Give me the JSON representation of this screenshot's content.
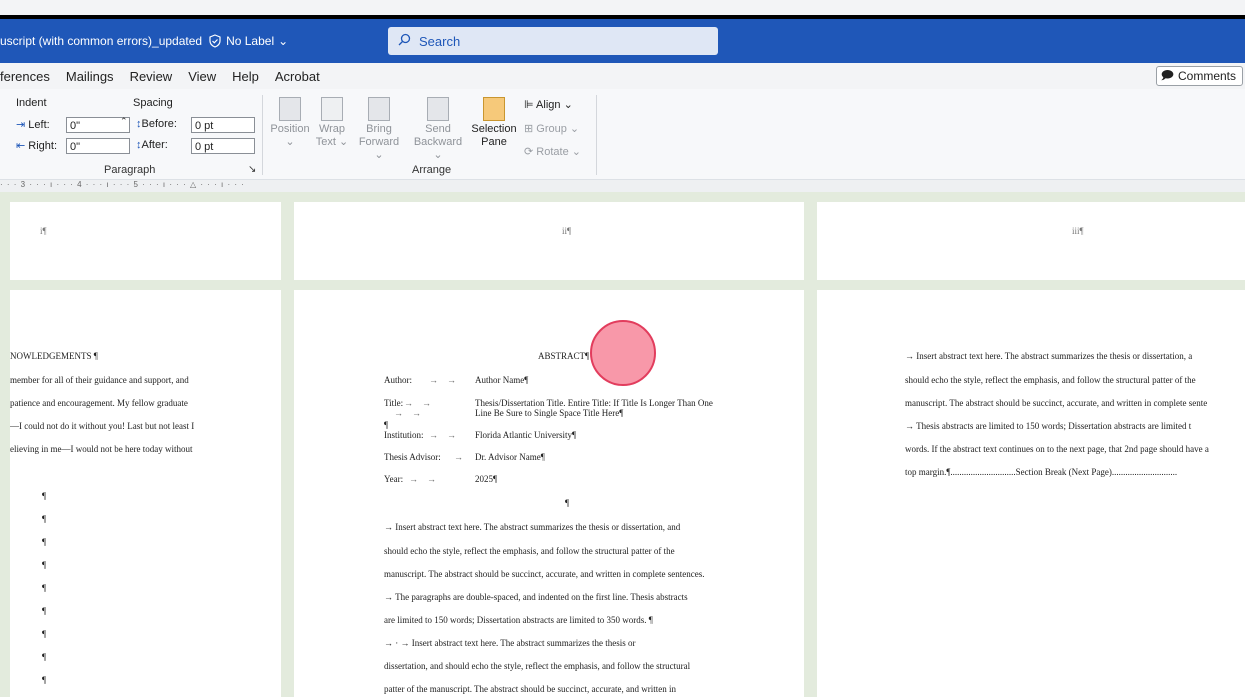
{
  "title_bar": {
    "doc_title": "uscript (with common errors)_updated",
    "label": "No Label",
    "search_placeholder": "Search",
    "colors": {
      "bar": "#1f57b8"
    }
  },
  "menu": {
    "tabs": [
      "ferences",
      "Mailings",
      "Review",
      "View",
      "Help",
      "Acrobat"
    ],
    "comments_label": "Comments"
  },
  "ribbon": {
    "indent": {
      "title": "Indent",
      "left_label": "Left:",
      "left_value": "0\"",
      "right_label": "Right:",
      "right_value": "0\""
    },
    "spacing": {
      "title": "Spacing",
      "before_label": "Before:",
      "before_value": "0 pt",
      "after_label": "After:",
      "after_value": "0 pt"
    },
    "paragraph_group_label": "Paragraph",
    "arrange": {
      "position": "Position",
      "wrap": [
        "Wrap",
        "Text"
      ],
      "bring": [
        "Bring",
        "Forward"
      ],
      "send": [
        "Send",
        "Backward"
      ],
      "selection": [
        "Selection",
        "Pane"
      ],
      "align": "Align",
      "group": "Group",
      "rotate": "Rotate",
      "group_label": "Arrange"
    }
  },
  "ruler_text": "· · · 3 · · · ı · · · 4 · · · ı · · · 5 · · · ı · · · △ · · · ı · · ·",
  "pages_top": [
    {
      "num": "i¶"
    },
    {
      "num": "ii¶"
    },
    {
      "num": "iii¶"
    }
  ],
  "page_left": {
    "heading": "NOWLEDGEMENTS ¶",
    "lines": [
      "member for all of their guidance and support, and",
      "patience and encouragement. My fellow graduate",
      "—I could not do it without you! Last but not least I",
      "elieving in me—I would not be here today without"
    ],
    "pilcrows": [
      "¶",
      "¶",
      "¶",
      "¶",
      "¶",
      "¶",
      "¶",
      "¶",
      "¶"
    ]
  },
  "page_mid": {
    "heading": "ABSTRACT¶",
    "fields": [
      {
        "label": "Author:",
        "value": "Author Name¶"
      },
      {
        "label": "Title:",
        "value": "Thesis/Dissertation Title. Entire Title: If Title Is Longer Than One"
      },
      {
        "label": "",
        "value": "Line Be Sure to Single Space Title Here¶"
      },
      {
        "label": "¶",
        "value": ""
      },
      {
        "label": "Institution:",
        "value": "Florida Atlantic University¶"
      },
      {
        "label": "Thesis Advisor:",
        "value": "Dr. Advisor Name¶"
      },
      {
        "label": "Year:",
        "value": "2025¶"
      }
    ],
    "center_pilcrow": "¶",
    "body": [
      "→   Insert abstract text here. The abstract summarizes the thesis or dissertation, and",
      "should echo the style, reflect the emphasis, and follow the structural patter of the",
      "manuscript. The abstract should be succinct, accurate, and written in complete sentences.",
      "→   The paragraphs are double-spaced, and indented on the first line. Thesis abstracts",
      "are limited to 150 words; Dissertation abstracts are limited to 350 words. ¶",
      "→  ·  →   Insert abstract text here. The abstract summarizes the thesis or",
      "dissertation, and should echo the style, reflect the emphasis, and follow the structural",
      "patter of the manuscript. The abstract should be succinct, accurate, and written in"
    ]
  },
  "page_right": {
    "lines": [
      "→   Insert abstract text here. The abstract summarizes the thesis or dissertation, a",
      "should echo the style, reflect the emphasis, and follow the structural patter of the",
      "manuscript. The abstract should be succinct, accurate, and written in complete sente",
      "→   Thesis abstracts are limited to 150 words; Dissertation abstracts are limited t",
      "words. If the abstract text continues on to the next page, that 2nd page should have a"
    ],
    "section_break": "top margin.¶.............................Section Break (Next Page)............................."
  }
}
